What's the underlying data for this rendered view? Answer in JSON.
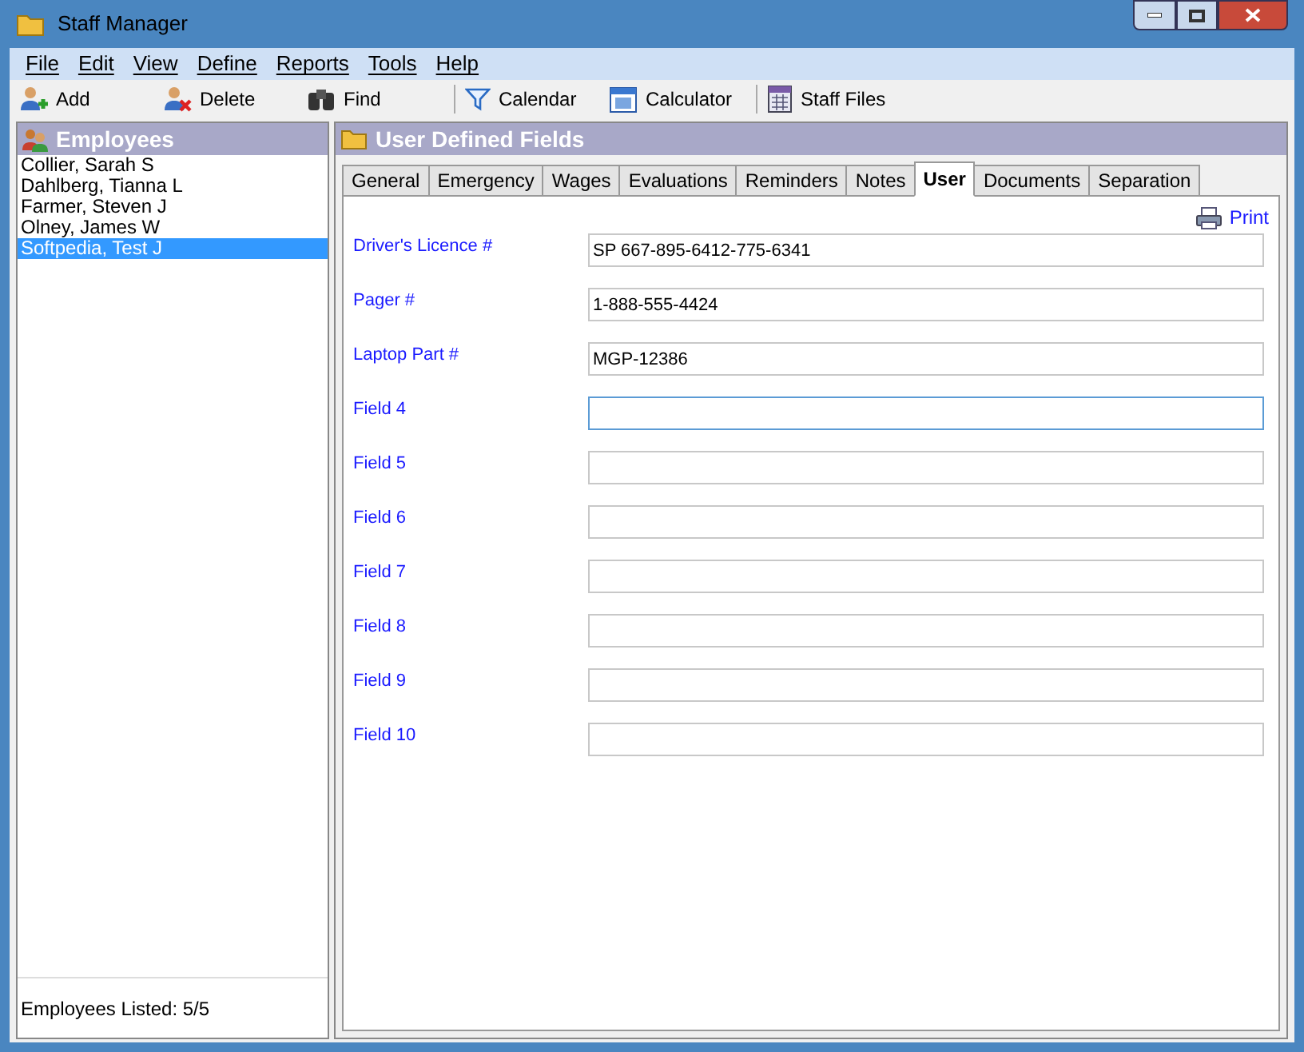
{
  "window": {
    "title": "Staff Manager"
  },
  "menu": [
    "File",
    "Edit",
    "View",
    "Define",
    "Reports",
    "Tools",
    "Help"
  ],
  "toolbar": [
    {
      "label": "Add",
      "kind": "add"
    },
    {
      "label": "Delete",
      "kind": "delete"
    },
    {
      "label": "Find",
      "kind": "find"
    },
    {
      "label": "Calendar",
      "kind": "calendar"
    },
    {
      "label": "Calculator",
      "kind": "calculator"
    },
    {
      "label": "Staff Files",
      "kind": "files"
    }
  ],
  "employees": {
    "title": "Employees",
    "items": [
      {
        "name": "Collier, Sarah S",
        "selected": false
      },
      {
        "name": "Dahlberg, Tianna L",
        "selected": false
      },
      {
        "name": "Farmer, Steven J",
        "selected": false
      },
      {
        "name": "Olney, James W",
        "selected": false
      },
      {
        "name": "Softpedia, Test J",
        "selected": true
      }
    ],
    "footer": "Employees Listed: 5/5"
  },
  "panel": {
    "title": "User Defined Fields",
    "tabs": [
      {
        "label": "General",
        "selected": false
      },
      {
        "label": "Emergency",
        "selected": false
      },
      {
        "label": "Wages",
        "selected": false
      },
      {
        "label": "Evaluations",
        "selected": false
      },
      {
        "label": "Reminders",
        "selected": false
      },
      {
        "label": "Notes",
        "selected": false
      },
      {
        "label": "User",
        "selected": true
      },
      {
        "label": "Documents",
        "selected": false
      },
      {
        "label": "Separation",
        "selected": false
      }
    ],
    "print": "Print",
    "fields": [
      {
        "label": "Driver's Licence #",
        "value": "SP 667-895-6412-775-6341",
        "focused": false
      },
      {
        "label": "Pager #",
        "value": "1-888-555-4424",
        "focused": false
      },
      {
        "label": "Laptop Part #",
        "value": "MGP-12386",
        "focused": false
      },
      {
        "label": "Field 4",
        "focused": true
      },
      {
        "label": "Field 5",
        "focused": false
      },
      {
        "label": "Field 6",
        "focused": false
      },
      {
        "label": "Field 7",
        "focused": false
      },
      {
        "label": "Field 8",
        "focused": false
      },
      {
        "label": "Field 9",
        "focused": false
      },
      {
        "label": "Field 10",
        "focused": false
      }
    ]
  }
}
